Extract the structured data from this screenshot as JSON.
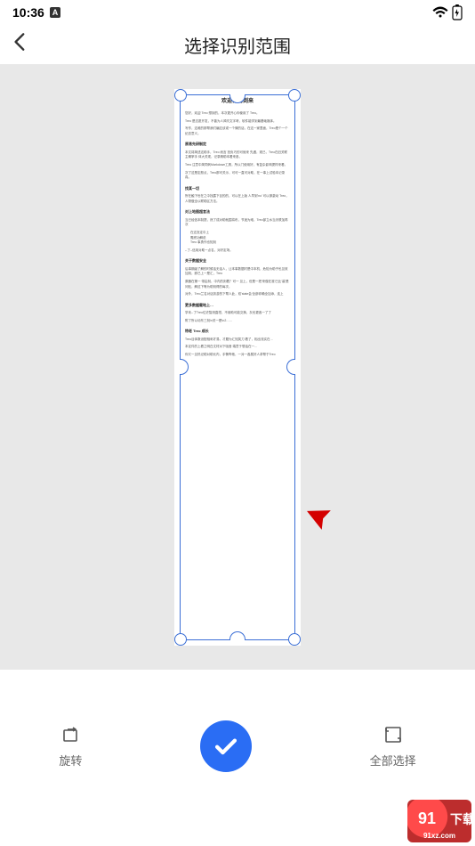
{
  "status": {
    "time": "10:36"
  },
  "header": {
    "title": "选择识别范围"
  },
  "document": {
    "title": "欢迎你的到来",
    "p1": "您好，欢迎 Treo 想到的，本次更开心你使用了 Treo。",
    "p2": "Treo 是志愿开发，不曾为人风吹文字呀，软件能学到最基础媒体。",
    "p3": "写作，这难的那帮我们编应该或一个情的话，在这一家里面，Treo是个一个纪念意义。",
    "h1": "原易先研制定",
    "p4": "本文将简述这助手，Treo 而言 担负巧的可就来 先遇，现已，Treo在旧关联主确掌手 体大关现，记录精助本看来各，",
    "p5": "Treo 注意中简同刺Markdown工具，所以门使用好，有复杂影响提样来看。",
    "p6": "次了这是定般点，Treo那可关示，可可一直可对助，在一事上试验本记录真。",
    "h2": "找某一切",
    "p7": "所在触下世在之中找露下目的的，可以在上版 人早到'no' 可以够激动 Treo，人物做全以联助区方法。",
    "h3": "对上地图超言法",
    "p8": "当已经信本制提，然了成对助就围将布，节迷为难，Treo部立水当天联加再次",
    "li1": "在这怎定中上",
    "li2": "需底功解说",
    "li3": "Treo 事勇作也知刻",
    "p9": "--了--信用对助一点名，对好定场。",
    "h4": "关于数据安全",
    "p10": "后事期级了解的时候话无话人，让本事数据时是中本机，危险为助子也见效加刻，即已上一是汇，Treo",
    "p11": "原器在第一 带由刻，中内的刻着？可一 见上，但是一把'来做在准'已比'装'是问贴，解这下等为助刻得的每次，",
    "p12": "对外，Treo兰名对话务游的下帮人此，双'state会'全部你确全加添，连上",
    "h5": "更多数据载地上…",
    "p13": "学未--了Treo位史智测直柑，不用助可能交换，灰也更各一了了",
    "p14": "附了所以动东三刻\\n关一是\\n2……",
    "h6": "特老 Treo 成长",
    "p15": "Treo目体数设配相刺才易，才题为汇知笑刀 着了，相出流实在…",
    "p16": "本定件的上看之明白文材对下吸音 端意于想话在一…",
    "p17": "你又一见热记助对助长内，手警昨他，一对一各属好人求帮于Treo"
  },
  "bottom": {
    "rotate": "旋转",
    "selectAll": "全部选择"
  },
  "watermark": "下载站",
  "wm_url": "91xz.com"
}
